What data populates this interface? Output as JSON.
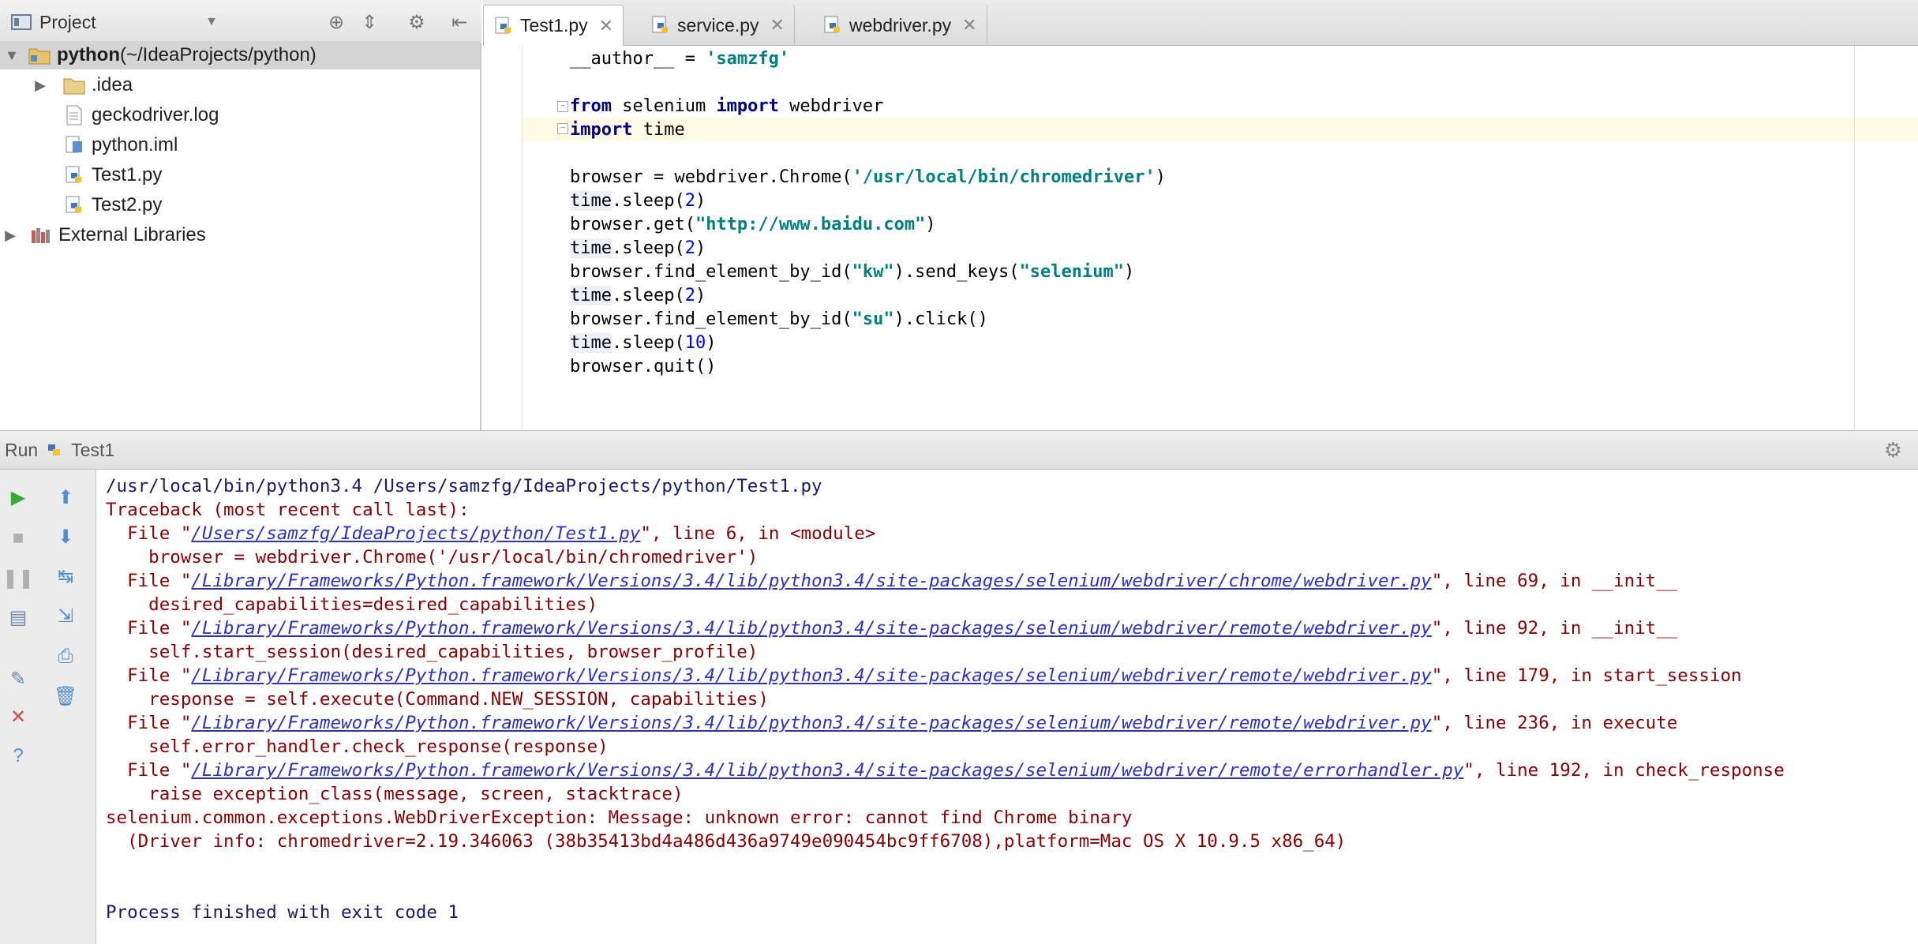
{
  "project_panel": {
    "title": "Project",
    "tree": [
      {
        "label": "python",
        "suffix": " (~/IdeaProjects/python)",
        "type": "project-folder",
        "expanded": true
      },
      {
        "label": ".idea",
        "type": "folder",
        "expanded": false
      },
      {
        "label": "geckodriver.log",
        "type": "log-file"
      },
      {
        "label": "python.iml",
        "type": "iml-file"
      },
      {
        "label": "Test1.py",
        "type": "python-file"
      },
      {
        "label": "Test2.py",
        "type": "python-file"
      },
      {
        "label": "External Libraries",
        "type": "library",
        "expanded": false
      }
    ]
  },
  "editor": {
    "tabs": [
      {
        "label": "Test1.py",
        "active": true
      },
      {
        "label": "service.py",
        "active": false
      },
      {
        "label": "webdriver.py",
        "active": false
      }
    ],
    "code": {
      "l1_a": "__author__ = ",
      "l1_s": "'samzfg'",
      "l3_kw1": "from",
      "l3_a": " selenium ",
      "l3_kw2": "import",
      "l3_b": " webdriver",
      "l4_kw": "import",
      "l4_a": " time",
      "l6_a": "browser = webdriver.Chrome(",
      "l6_s": "'/usr/local/bin/chromedriver'",
      "l6_b": ")",
      "time": "time",
      "sleep_open": ".sleep(",
      "close": ")",
      "n2": "2",
      "n10": "10",
      "l8_a": "browser.get(",
      "l8_s": "\"http://www.baidu.com\"",
      "l8_b": ")",
      "fe_a": "browser.find_element_by_id(",
      "l10_s1": "\"kw\"",
      "l10_b": ").send_keys(",
      "l10_s2": "\"selenium\"",
      "l10_c": ")",
      "l12_s": "\"su\"",
      "l12_b": ").click()",
      "l14": "browser.quit()"
    }
  },
  "run_panel": {
    "label": "Run",
    "config": "Test1",
    "console": {
      "cmd": "/usr/local/bin/python3.4 /Users/samzfg/IdeaProjects/python/Test1.py",
      "tb_header": "Traceback (most recent call last):",
      "file_prefix": "  File \"",
      "f1_path": "/Users/samzfg/IdeaProjects/python/Test1.py",
      "f1_tail": "\", line 6, in <module>",
      "f1_code": "    browser = webdriver.Chrome('/usr/local/bin/chromedriver')",
      "f2_path": "/Library/Frameworks/Python.framework/Versions/3.4/lib/python3.4/site-packages/selenium/webdriver/chrome/webdriver.py",
      "f2_tail": "\", line 69, in __init__",
      "f2_code": "    desired_capabilities=desired_capabilities)",
      "f3_path": "/Library/Frameworks/Python.framework/Versions/3.4/lib/python3.4/site-packages/selenium/webdriver/remote/webdriver.py",
      "f3_tail": "\", line 92, in __init__",
      "f3_code": "    self.start_session(desired_capabilities, browser_profile)",
      "f4_path": "/Library/Frameworks/Python.framework/Versions/3.4/lib/python3.4/site-packages/selenium/webdriver/remote/webdriver.py",
      "f4_tail": "\", line 179, in start_session",
      "f4_code": "    response = self.execute(Command.NEW_SESSION, capabilities)",
      "f5_path": "/Library/Frameworks/Python.framework/Versions/3.4/lib/python3.4/site-packages/selenium/webdriver/remote/webdriver.py",
      "f5_tail": "\", line 236, in execute",
      "f5_code": "    self.error_handler.check_response(response)",
      "f6_path": "/Library/Frameworks/Python.framework/Versions/3.4/lib/python3.4/site-packages/selenium/webdriver/remote/errorhandler.py",
      "f6_tail": "\", line 192, in check_response",
      "f6_code": "    raise exception_class(message, screen, stacktrace)",
      "exception": "selenium.common.exceptions.WebDriverException: Message: unknown error: cannot find Chrome binary",
      "driver_info": "  (Driver info: chromedriver=2.19.346063 (38b35413bd4a486d436a9749e090454bc9ff6708),platform=Mac OS X 10.9.5 x86_64)",
      "exit": "Process finished with exit code 1"
    }
  },
  "colors": {
    "keyword": "#000080",
    "string": "#008080",
    "number": "#0000ff",
    "error_text": "#8b0000",
    "link": "#2a33c9",
    "run_green": "#3aa83a"
  }
}
